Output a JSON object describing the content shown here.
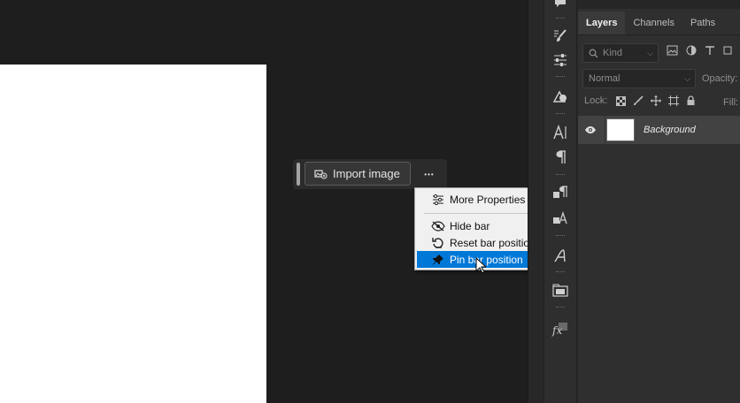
{
  "taskbar": {
    "import_label": "Import image",
    "more_glyph": "•••"
  },
  "menu": {
    "items": [
      {
        "label": "More Properties",
        "icon": "sliders-icon"
      },
      {
        "label": "Hide bar",
        "icon": "eye-slash-icon"
      },
      {
        "label": "Reset bar position",
        "icon": "reset-icon"
      },
      {
        "label": "Pin bar position",
        "icon": "pin-icon",
        "highlighted": true
      }
    ]
  },
  "panel": {
    "tabs": [
      {
        "label": "Layers",
        "active": true
      },
      {
        "label": "Channels"
      },
      {
        "label": "Paths"
      }
    ],
    "kind_placeholder": "Kind",
    "blend_mode": "Normal",
    "opacity_label": "Opacity:",
    "lock_label": "Lock:",
    "fill_label": "Fill:",
    "layer": {
      "name": "Background"
    }
  },
  "colors": {
    "highlight": "#0078d7",
    "canvas_bg": "#1e1e1e",
    "document": "#ffffff"
  }
}
